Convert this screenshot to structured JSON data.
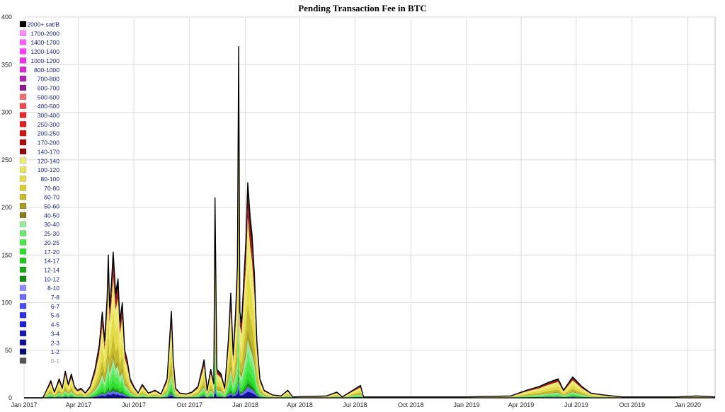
{
  "chart_data": {
    "type": "area",
    "title": "Pending Transaction Fee in BTC",
    "xlabel": "",
    "ylabel": "",
    "ylim": [
      0,
      400
    ],
    "y_ticks": [
      0,
      50,
      100,
      150,
      200,
      250,
      300,
      350,
      400
    ],
    "xlim": [
      "2017-01-01",
      "2020-02-15"
    ],
    "x_ticks": [
      {
        "date": "2017-01-01",
        "label": "Jan 2017"
      },
      {
        "date": "2017-04-01",
        "label": "Apr 2017"
      },
      {
        "date": "2017-07-01",
        "label": "Jul 2017"
      },
      {
        "date": "2017-10-01",
        "label": "Oct 2017"
      },
      {
        "date": "2018-01-01",
        "label": "Jan 2018"
      },
      {
        "date": "2018-04-01",
        "label": "Apr 2018"
      },
      {
        "date": "2018-07-01",
        "label": "Jul 2018"
      },
      {
        "date": "2018-10-01",
        "label": "Oct 2018"
      },
      {
        "date": "2019-01-01",
        "label": "Jan 2019"
      },
      {
        "date": "2019-04-01",
        "label": "Apr 2019"
      },
      {
        "date": "2019-07-01",
        "label": "Jul 2019"
      },
      {
        "date": "2019-10-01",
        "label": "Oct 2019"
      },
      {
        "date": "2020-01-01",
        "label": "Jan 2020"
      }
    ],
    "grid": true,
    "legend_position": "top-left",
    "total_series": {
      "name": "2000+ sat/B",
      "color": "#000000",
      "points": [
        [
          "2017-01-01",
          0
        ],
        [
          "2017-02-01",
          0
        ],
        [
          "2017-02-10",
          12
        ],
        [
          "2017-02-14",
          18
        ],
        [
          "2017-02-20",
          6
        ],
        [
          "2017-02-28",
          20
        ],
        [
          "2017-03-05",
          10
        ],
        [
          "2017-03-10",
          28
        ],
        [
          "2017-03-15",
          14
        ],
        [
          "2017-03-20",
          25
        ],
        [
          "2017-03-25",
          12
        ],
        [
          "2017-03-30",
          8
        ],
        [
          "2017-04-05",
          10
        ],
        [
          "2017-04-12",
          5
        ],
        [
          "2017-04-20",
          12
        ],
        [
          "2017-04-28",
          30
        ],
        [
          "2017-05-05",
          55
        ],
        [
          "2017-05-10",
          90
        ],
        [
          "2017-05-14",
          60
        ],
        [
          "2017-05-18",
          105
        ],
        [
          "2017-05-20",
          150
        ],
        [
          "2017-05-22",
          95
        ],
        [
          "2017-05-25",
          118
        ],
        [
          "2017-05-28",
          153
        ],
        [
          "2017-06-01",
          110
        ],
        [
          "2017-06-05",
          125
        ],
        [
          "2017-06-08",
          80
        ],
        [
          "2017-06-12",
          100
        ],
        [
          "2017-06-16",
          50
        ],
        [
          "2017-06-20",
          40
        ],
        [
          "2017-06-25",
          20
        ],
        [
          "2017-07-01",
          12
        ],
        [
          "2017-07-08",
          5
        ],
        [
          "2017-07-15",
          14
        ],
        [
          "2017-07-25",
          5
        ],
        [
          "2017-08-05",
          8
        ],
        [
          "2017-08-15",
          4
        ],
        [
          "2017-08-25",
          20
        ],
        [
          "2017-09-01",
          91
        ],
        [
          "2017-09-04",
          40
        ],
        [
          "2017-09-08",
          10
        ],
        [
          "2017-09-15",
          5
        ],
        [
          "2017-09-25",
          4
        ],
        [
          "2017-10-05",
          6
        ],
        [
          "2017-10-15",
          12
        ],
        [
          "2017-10-25",
          40
        ],
        [
          "2017-10-30",
          8
        ],
        [
          "2017-11-05",
          30
        ],
        [
          "2017-11-10",
          15
        ],
        [
          "2017-11-12",
          210
        ],
        [
          "2017-11-15",
          30
        ],
        [
          "2017-11-22",
          25
        ],
        [
          "2017-11-28",
          10
        ],
        [
          "2017-12-04",
          60
        ],
        [
          "2017-12-08",
          110
        ],
        [
          "2017-12-12",
          45
        ],
        [
          "2017-12-16",
          90
        ],
        [
          "2017-12-19",
          140
        ],
        [
          "2017-12-21",
          369
        ],
        [
          "2017-12-23",
          90
        ],
        [
          "2017-12-26",
          80
        ],
        [
          "2017-12-30",
          130
        ],
        [
          "2018-01-02",
          165
        ],
        [
          "2018-01-05",
          226
        ],
        [
          "2018-01-09",
          190
        ],
        [
          "2018-01-12",
          172
        ],
        [
          "2018-01-16",
          130
        ],
        [
          "2018-01-20",
          60
        ],
        [
          "2018-01-25",
          20
        ],
        [
          "2018-02-01",
          8
        ],
        [
          "2018-02-15",
          3
        ],
        [
          "2018-03-01",
          2
        ],
        [
          "2018-03-12",
          8
        ],
        [
          "2018-03-20",
          1
        ],
        [
          "2018-05-15",
          2
        ],
        [
          "2018-06-01",
          6
        ],
        [
          "2018-06-10",
          1
        ],
        [
          "2018-07-10",
          13
        ],
        [
          "2018-07-15",
          1
        ],
        [
          "2018-10-01",
          1
        ],
        [
          "2019-01-01",
          1
        ],
        [
          "2019-03-15",
          2
        ],
        [
          "2019-04-10",
          8
        ],
        [
          "2019-05-01",
          12
        ],
        [
          "2019-05-15",
          16
        ],
        [
          "2019-06-01",
          20
        ],
        [
          "2019-06-10",
          8
        ],
        [
          "2019-06-25",
          22
        ],
        [
          "2019-07-10",
          12
        ],
        [
          "2019-07-25",
          5
        ],
        [
          "2019-08-15",
          3
        ],
        [
          "2019-09-15",
          1
        ],
        [
          "2019-10-15",
          1
        ],
        [
          "2019-12-15",
          1
        ],
        [
          "2020-01-15",
          2
        ],
        [
          "2020-02-15",
          1
        ]
      ]
    },
    "stack_shares": {
      "2000+ sat/B": 0.06,
      "170-200": 0.06,
      "140-170": 0.04,
      "120-140": 0.22,
      "80-100": 0.18,
      "60-70": 0.12,
      "50-60": 0.05,
      "30-40": 0.05,
      "25-30": 0.04,
      "20-25": 0.05,
      "17-20": 0.04,
      "14-17": 0.02,
      "10-12": 0.02,
      "7-8": 0.02,
      "2-3": 0.03
    },
    "legend": [
      {
        "label": "2000+ sat/B",
        "color": "#000000"
      },
      {
        "label": "1700-2000",
        "color": "#ff8cff"
      },
      {
        "label": "1400-1700",
        "color": "#ff66ff"
      },
      {
        "label": "1200-1400",
        "color": "#ff40ff"
      },
      {
        "label": "1000-1200",
        "color": "#f033e8"
      },
      {
        "label": "800-1000",
        "color": "#d42ecf"
      },
      {
        "label": "700-800",
        "color": "#b026b0"
      },
      {
        "label": "600-700",
        "color": "#8a1e8a"
      },
      {
        "label": "500-600",
        "color": "#f07070"
      },
      {
        "label": "400-500",
        "color": "#f04a4a"
      },
      {
        "label": "300-400",
        "color": "#ee2a2a"
      },
      {
        "label": "250-300",
        "color": "#e01e1e"
      },
      {
        "label": "200-250",
        "color": "#cc1414"
      },
      {
        "label": "170-200",
        "color": "#b00e0e"
      },
      {
        "label": "140-170",
        "color": "#8c0a0a"
      },
      {
        "label": "120-140",
        "color": "#eeea78"
      },
      {
        "label": "100-120",
        "color": "#e8e25e"
      },
      {
        "label": "80-100",
        "color": "#e4dc46"
      },
      {
        "label": "70-80",
        "color": "#d8cf36"
      },
      {
        "label": "60-70",
        "color": "#c4ba2c"
      },
      {
        "label": "50-60",
        "color": "#a69c22"
      },
      {
        "label": "40-50",
        "color": "#857c1c"
      },
      {
        "label": "30-40",
        "color": "#9ce89c"
      },
      {
        "label": "25-30",
        "color": "#6ee86e"
      },
      {
        "label": "20-25",
        "color": "#4ae84a"
      },
      {
        "label": "17-20",
        "color": "#2ee02e"
      },
      {
        "label": "14-17",
        "color": "#22c422"
      },
      {
        "label": "12-14",
        "color": "#1aa81a"
      },
      {
        "label": "10-12",
        "color": "#148a14"
      },
      {
        "label": "8-10",
        "color": "#8c8cff"
      },
      {
        "label": "7-8",
        "color": "#6a6aff"
      },
      {
        "label": "6-7",
        "color": "#4a4aff"
      },
      {
        "label": "5-6",
        "color": "#3030f0"
      },
      {
        "label": "4-5",
        "color": "#2020d8"
      },
      {
        "label": "3-4",
        "color": "#1818b8"
      },
      {
        "label": "2-3",
        "color": "#121298"
      },
      {
        "label": "1-2",
        "color": "#0c0c78"
      },
      {
        "label": "0-1",
        "color": "#555555",
        "muted": true
      }
    ]
  }
}
